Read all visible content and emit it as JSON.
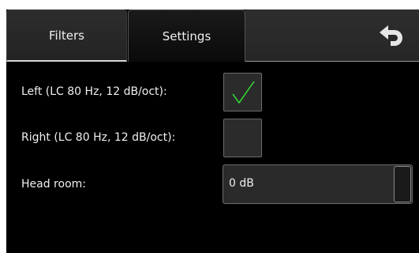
{
  "tabs": [
    {
      "label": "Filters",
      "active": true
    },
    {
      "label": "Settings",
      "active": false
    }
  ],
  "toolbar": {
    "undo_icon": "undo-icon"
  },
  "settings": {
    "left_filter": {
      "label": "Left (LC 80 Hz, 12 dB/oct):",
      "checked": true
    },
    "right_filter": {
      "label": "Right (LC 80 Hz, 12 dB/oct):",
      "checked": false
    },
    "head_room": {
      "label": "Head room:",
      "value": "0 dB"
    }
  },
  "colors": {
    "check_mark": "#33dd33",
    "background": "#000000"
  }
}
